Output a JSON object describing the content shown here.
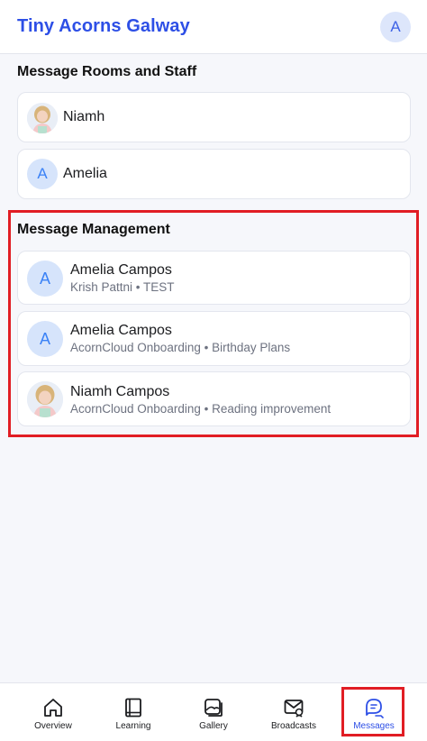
{
  "header": {
    "title": "Tiny Acorns Galway",
    "avatar_initial": "A"
  },
  "rooms_section": {
    "title": "Message Rooms and Staff",
    "items": [
      {
        "name": "Niamh",
        "avatar": "photo"
      },
      {
        "name": "Amelia",
        "avatar_initial": "A"
      }
    ]
  },
  "management_section": {
    "title": "Message Management",
    "items": [
      {
        "name": "Amelia Campos",
        "subtitle": "Krish Pattni • TEST",
        "avatar_initial": "A"
      },
      {
        "name": "Amelia Campos",
        "subtitle": "AcornCloud Onboarding • Birthday Plans",
        "avatar_initial": "A"
      },
      {
        "name": "Niamh Campos",
        "subtitle": "AcornCloud Onboarding • Reading improvement",
        "avatar": "photo"
      }
    ]
  },
  "bottom_nav": {
    "items": [
      {
        "label": "Overview",
        "icon": "home-icon"
      },
      {
        "label": "Learning",
        "icon": "book-icon"
      },
      {
        "label": "Gallery",
        "icon": "gallery-icon"
      },
      {
        "label": "Broadcasts",
        "icon": "broadcast-icon"
      },
      {
        "label": "Messages",
        "icon": "messages-icon",
        "active": true
      }
    ]
  },
  "colors": {
    "accent": "#2d4fe6",
    "highlight": "#e11d24",
    "avatar_bg": "#d6e4fb"
  }
}
